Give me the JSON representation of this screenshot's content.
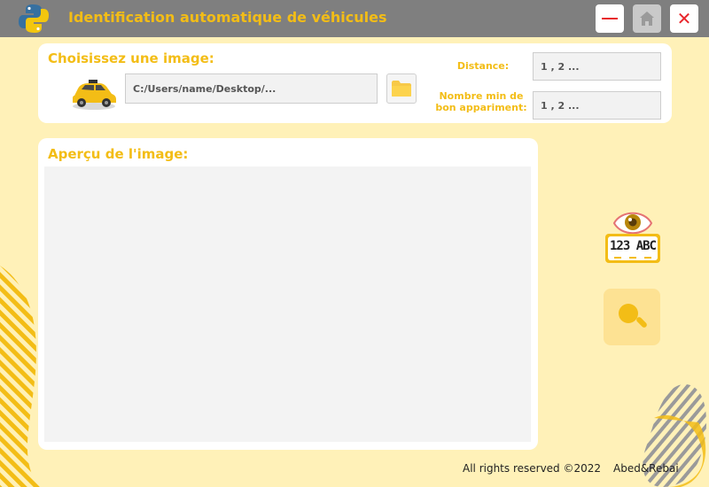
{
  "window": {
    "title": "Identification automatique de véhicules",
    "buttons": {
      "minimize": "minimize-icon",
      "home": "home-icon",
      "close": "close-icon"
    }
  },
  "image_selection": {
    "title": "Choisissez une image:",
    "path_value": "C:/Users/name/Desktop/...",
    "browse_icon": "folder-icon",
    "car_icon": "taxi-car-icon"
  },
  "parameters": {
    "distance_label": "Distance:",
    "distance_placeholder": "1 , 2 ...",
    "min_match_label_line1": "Nombre min de",
    "min_match_label_line2": "bon appariment:",
    "min_match_placeholder": "1 , 2 ..."
  },
  "preview": {
    "title": "Aperçu de l'image:"
  },
  "side": {
    "plate_text": "123 ABC",
    "logo_icon": "eye-plate-icon",
    "search_icon": "magnifier-icon"
  },
  "footer": {
    "copyright": "All rights reserved ©2022",
    "authors": "Abed&Rebai"
  },
  "colors": {
    "accent": "#f3bd16",
    "background": "#fff1b8",
    "titlebar": "#7f7f7f",
    "close_red": "#e8252b"
  }
}
